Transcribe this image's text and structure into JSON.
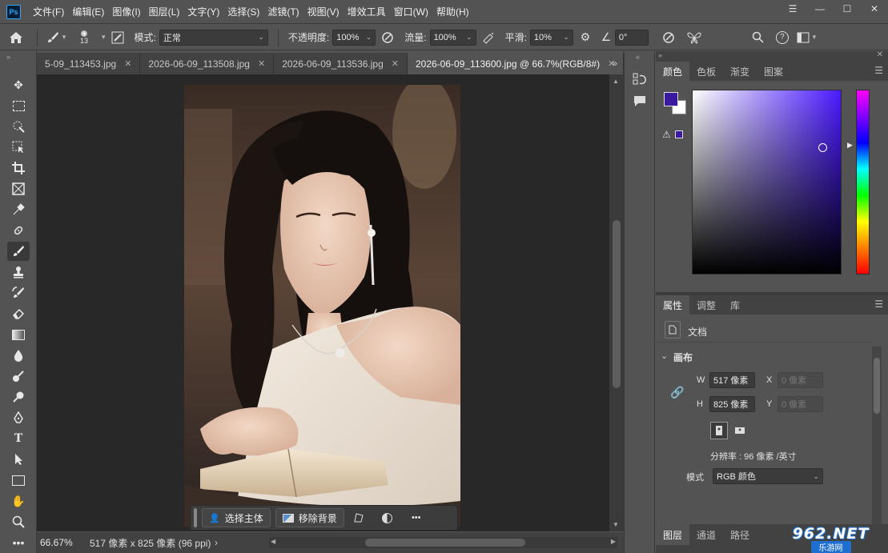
{
  "app": {
    "logo": "Ps"
  },
  "menu": [
    "文件(F)",
    "编辑(E)",
    "图像(I)",
    "图层(L)",
    "文字(Y)",
    "选择(S)",
    "滤镜(T)",
    "视图(V)",
    "增效工具",
    "窗口(W)",
    "帮助(H)"
  ],
  "window_controls": {
    "icons": [
      "menu-icon",
      "minimize-icon",
      "maximize-icon",
      "close-icon"
    ]
  },
  "options": {
    "brush_size": "13",
    "mode_label": "模式:",
    "mode_value": "正常",
    "opacity_label": "不透明度:",
    "opacity_value": "100%",
    "flow_label": "流量:",
    "flow_value": "100%",
    "smooth_label": "平滑:",
    "smooth_value": "10%",
    "angle_value": "0°"
  },
  "tabs": [
    {
      "label": "5-09_113453.jpg",
      "active": false
    },
    {
      "label": "2026-06-09_113508.jpg",
      "active": false
    },
    {
      "label": "2026-06-09_113536.jpg",
      "active": false
    },
    {
      "label": "2026-06-09_113600.jpg @ 66.7%(RGB/8#)",
      "active": true
    }
  ],
  "taskbar": {
    "select_subject": "选择主体",
    "remove_bg": "移除背景",
    "more": "•••"
  },
  "status": {
    "zoom": "66.67%",
    "info": "517 像素 x 825 像素 (96 ppi)"
  },
  "color_panel": {
    "tabs": [
      "颜色",
      "色板",
      "渐变",
      "图案"
    ],
    "foreground_color": "#3a1a9e",
    "background_color": "#ffffff"
  },
  "props_panel": {
    "tabs": [
      "属性",
      "调整",
      "库"
    ],
    "doc_label": "文档",
    "section_title": "画布",
    "w_label": "W",
    "w_value": "517 像素",
    "h_label": "H",
    "h_value": "825 像素",
    "x_label": "X",
    "x_placeholder": "0 像素",
    "y_label": "Y",
    "y_placeholder": "0 像素",
    "resolution": "分辨率 : 96 像素 /英寸",
    "mode_label": "模式",
    "mode_value": "RGB 颜色"
  },
  "bottom_tabs": [
    "图层",
    "通道",
    "路径"
  ],
  "watermark": {
    "brand": "962.NET",
    "sub": "乐游网"
  }
}
